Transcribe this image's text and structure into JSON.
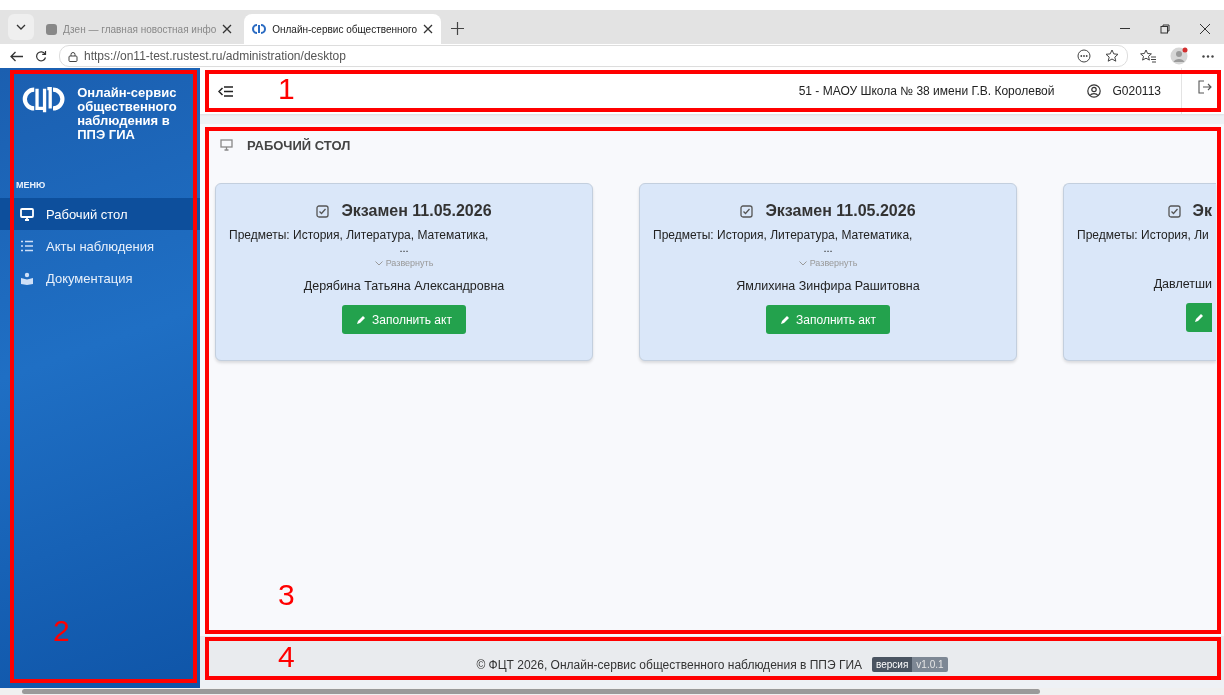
{
  "browser": {
    "tabs": [
      {
        "title": "Дзен — главная новостная инфо",
        "selected": false
      },
      {
        "title": "Онлайн-сервис общественного",
        "selected": true
      }
    ],
    "address": "https://on11-test.rustest.ru/administration/desktop"
  },
  "sidebar": {
    "logo_text": "Онлайн-сервис общественного наблюдения в ППЭ ГИА",
    "menu_label": "МЕНЮ",
    "items": [
      {
        "label": "Рабочий стол",
        "selected": true
      },
      {
        "label": "Акты наблюдения",
        "selected": false
      },
      {
        "label": "Документация",
        "selected": false
      }
    ]
  },
  "header": {
    "school": "51 - МАОУ Школа № 38 имени Г.В. Королевой",
    "user": "G020113"
  },
  "page_title": "РАБОЧИЙ СТОЛ",
  "cards": [
    {
      "kind": "full",
      "title": "Экзамен 11.05.2026",
      "subjects": "Предметы: История, Литература, Математика,",
      "more": "...",
      "expand": "Развернуть",
      "observer": "Дерябина Татьяна Александровна",
      "button": "Заполнить акт"
    },
    {
      "kind": "full",
      "title": "Экзамен 11.05.2026",
      "subjects": "Предметы: История, Литература, Математика,",
      "more": "...",
      "expand": "Развернуть",
      "observer": "Ямлихина Зинфира Рашитовна",
      "button": "Заполнить акт"
    },
    {
      "kind": "cut",
      "title": "Эк",
      "subjects": "Предметы: История, Ли",
      "observer": "Давлетши"
    }
  ],
  "footer": {
    "text": "© ФЦТ 2026, Онлайн-сервис общественного наблюдения в ППЭ ГИА",
    "version_label": "версия",
    "version": "v1.0.1"
  },
  "annotations": [
    {
      "label": "1"
    },
    {
      "label": "2"
    },
    {
      "label": "3"
    },
    {
      "label": "4"
    }
  ]
}
